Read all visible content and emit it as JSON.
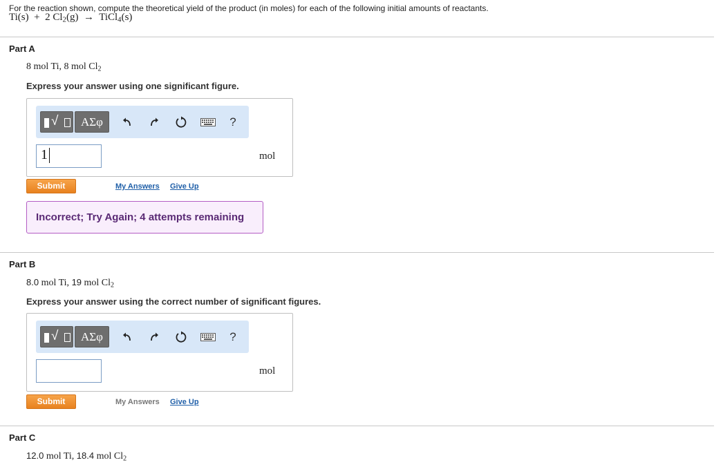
{
  "intro": "For the reaction shown, compute the theoretical yield of the product (in moles) for each of the following initial amounts of reactants.",
  "equation": {
    "reactant1": "Ti(s)",
    "plus": "+",
    "coef2": "2",
    "reactant2_main": "Cl",
    "reactant2_sub": "2",
    "reactant2_state": "(g)",
    "arrow": "→",
    "product_main": "TiCl",
    "product_sub": "4",
    "product_state": "(s)"
  },
  "toolbar": {
    "greek": "ΑΣφ",
    "help": "?",
    "icons": [
      "templates-icon",
      "greek-letters-icon",
      "undo-icon",
      "redo-icon",
      "reset-icon",
      "keyboard-icon",
      "help-icon"
    ]
  },
  "parts": [
    {
      "title": "Part A",
      "given_ti": "8 mol Ti,",
      "given_cl_pre": "8 mol Cl",
      "given_cl_sub": "2",
      "instruction": "Express your answer using one significant figure.",
      "answer_value": "1",
      "unit": "mol",
      "submit": "Submit",
      "my_answers": "My Answers",
      "give_up": "Give Up",
      "feedback": "Incorrect; Try Again; 4 attempts remaining"
    },
    {
      "title": "Part B",
      "given_num1": "8.0",
      "given_ti": "mol Ti,",
      "given_num2": "19",
      "given_cl_pre": "mol Cl",
      "given_cl_sub": "2",
      "instruction": "Express your answer using the correct number of significant figures.",
      "answer_value": "",
      "unit": "mol",
      "submit": "Submit",
      "my_answers": "My Answers",
      "give_up": "Give Up"
    },
    {
      "title": "Part C",
      "given_num1": "12.0",
      "given_ti": "mol Ti,",
      "given_num2": "18.4",
      "given_cl_pre": "mol Cl",
      "given_cl_sub": "2"
    }
  ],
  "colors": {
    "submit": "#f0912f",
    "toolbar_bg": "#d8e7f8",
    "feedback_border": "#b35cc4",
    "feedback_bg": "#f9eefc",
    "link": "#1f5fa8"
  }
}
